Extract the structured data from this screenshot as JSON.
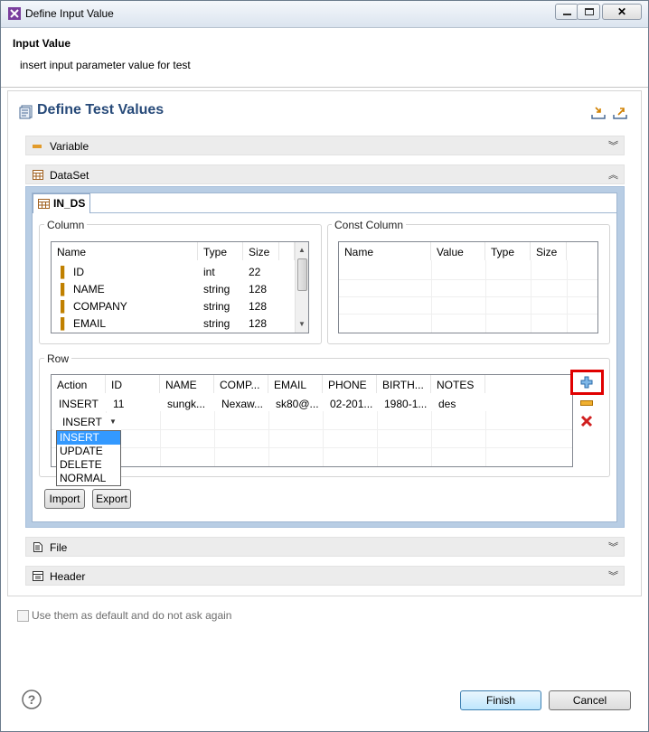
{
  "window": {
    "title": "Define Input Value"
  },
  "header": {
    "title": "Input Value",
    "description": "insert input parameter value for test"
  },
  "form": {
    "title": "Define Test Values"
  },
  "sections": {
    "variable": "Variable",
    "dataset": "DataSet",
    "file": "File",
    "header": "Header"
  },
  "dataset_tab": {
    "label": "IN_DS"
  },
  "column_group": {
    "label": "Column",
    "headers": [
      "Name",
      "Type",
      "Size"
    ],
    "rows": [
      {
        "name": "ID",
        "type": "int",
        "size": "22"
      },
      {
        "name": "NAME",
        "type": "string",
        "size": "128"
      },
      {
        "name": "COMPANY",
        "type": "string",
        "size": "128"
      },
      {
        "name": "EMAIL",
        "type": "string",
        "size": "128"
      }
    ]
  },
  "const_group": {
    "label": "Const Column",
    "headers": [
      "Name",
      "Value",
      "Type",
      "Size"
    ]
  },
  "row_group": {
    "label": "Row",
    "headers": [
      "Action",
      "ID",
      "NAME",
      "COMP...",
      "EMAIL",
      "PHONE",
      "BIRTH...",
      "NOTES"
    ],
    "row1": [
      "INSERT",
      "11",
      "sungk...",
      "Nexaw...",
      "sk80@...",
      "02-201...",
      "1980-1...",
      "des"
    ],
    "edit_value": "INSERT",
    "dropdown_options": [
      "INSERT",
      "UPDATE",
      "DELETE",
      "NORMAL"
    ],
    "dropdown_selected": "INSERT"
  },
  "buttons": {
    "import": "Import",
    "export": "Export",
    "finish": "Finish",
    "cancel": "Cancel"
  },
  "checkbox": {
    "label": "Use them as default and do not ask again",
    "checked": false
  },
  "colors": {
    "accent_title": "#274a79",
    "highlight_border": "#e00000",
    "selection": "#3399ff"
  }
}
